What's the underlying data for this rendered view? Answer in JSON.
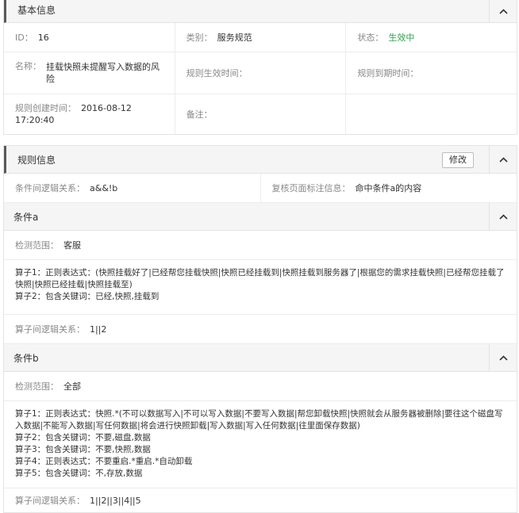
{
  "basic": {
    "title": "基本信息",
    "id_label": "ID：",
    "id_value": "16",
    "category_label": "类别：",
    "category_value": "服务规范",
    "status_label": "状态：",
    "status_value": "生效中",
    "name_label": "名称：",
    "name_value": "挂载快照未提醒写入数据的风险",
    "effective_label": "规则生效时间：",
    "effective_value": "",
    "expire_label": "规则到期时间：",
    "expire_value": "",
    "created_label": "规则创建时间：",
    "created_value": "2016-08-12 17:20:40",
    "remark_label": "备注：",
    "remark_value": ""
  },
  "rule": {
    "title": "规则信息",
    "edit_label": "修改",
    "logic_label": "条件间逻辑关系：",
    "logic_value": "a&&!b",
    "review_label": "复核页面标注信息：",
    "review_value": "命中条件a的内容"
  },
  "condition_a": {
    "title": "条件a",
    "scope_label": "检测范围：",
    "scope_value": "客服",
    "operators": [
      "算子1：正则表达式：(快照挂载好了|已经帮您挂载快照|快照已经挂载到|快照挂载到服务器了|根据您的需求挂载快照|已经帮您挂载了快照|快照已经挂载|快照挂载至)",
      "算子2：包含关键词：已经,快照,挂载到"
    ],
    "op_logic_label": "算子间逻辑关系：",
    "op_logic_value": "1||2"
  },
  "condition_b": {
    "title": "条件b",
    "scope_label": "检测范围：",
    "scope_value": "全部",
    "operators": [
      "算子1：正则表达式：快照.*(不可以数据写入|不可以写入数据|不要写入数据|帮您卸载快照|快照就会从服务器被删除|要往这个磁盘写入数据|不能写入数据|写任何数据|将会进行快照卸载|写入数据|写入任何数据|往里面保存数据)",
      "算子2：包含关键词：不要,磁盘,数据",
      "算子3：包含关键词：不要,快照,数据",
      "算子4：正则表达式：不要重启.*重启.*自动卸载",
      "算子5：包含关键词：不,存放,数据"
    ],
    "op_logic_label": "算子间逻辑关系：",
    "op_logic_value": "1||2||3||4||5"
  }
}
